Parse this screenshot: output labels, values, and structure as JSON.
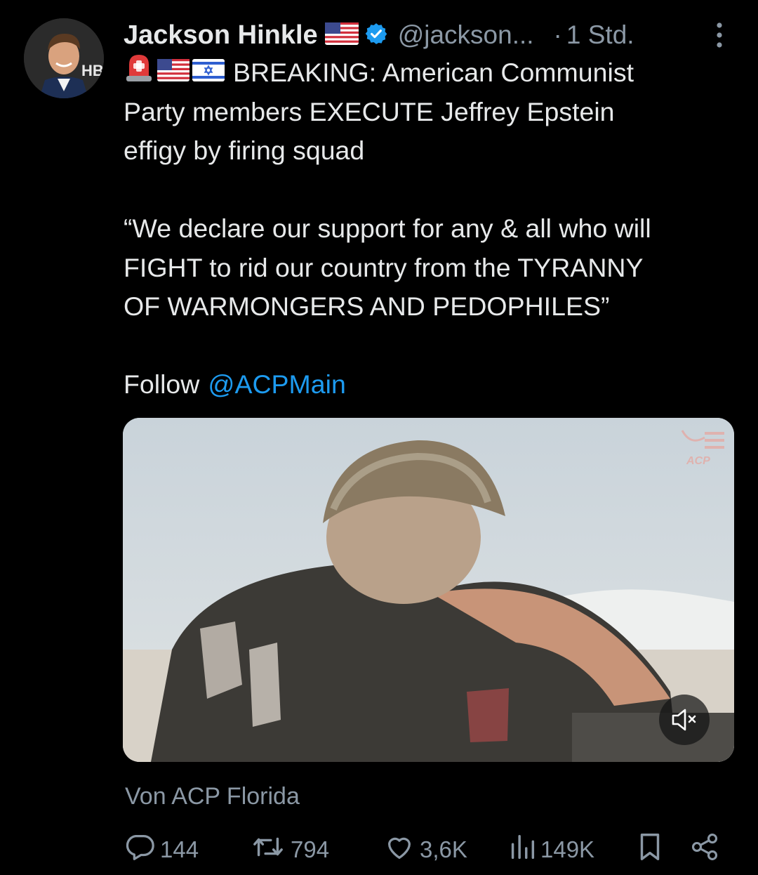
{
  "author": {
    "display_name": "Jackson Hinkle",
    "handle": "@jackson...",
    "time_sep": "·",
    "time": "1 Std.",
    "avatar_badge": "HB"
  },
  "post": {
    "line1": "BREAKING: American Communist",
    "line2": "Party members EXECUTE Jeffrey Epstein",
    "line3": "effigy by firing squad",
    "quote_line1": "“We declare our support for any & all who will",
    "quote_line2": "FIGHT to rid our country from the TYRANNY",
    "quote_line3": "OF WARMONGERS AND PEDOPHILES”",
    "follow_prefix": "Follow",
    "follow_link": "@ACPMain"
  },
  "media": {
    "watermark": "ACP"
  },
  "source": "Von ACP Florida",
  "metrics": {
    "replies": "144",
    "reposts": "794",
    "likes": "3,6K",
    "views": "149K"
  },
  "colors": {
    "background": "#000000",
    "text": "#e7e9ea",
    "secondary": "#8b98a5",
    "link": "#1d9bf0",
    "verified": "#1d9bf0"
  },
  "icons": [
    "more-icon",
    "verified-badge-icon",
    "us-flag-icon",
    "siren-icon",
    "israel-flag-icon",
    "mute-icon",
    "reply-icon",
    "repost-icon",
    "like-icon",
    "views-icon",
    "bookmark-icon",
    "share-icon"
  ]
}
